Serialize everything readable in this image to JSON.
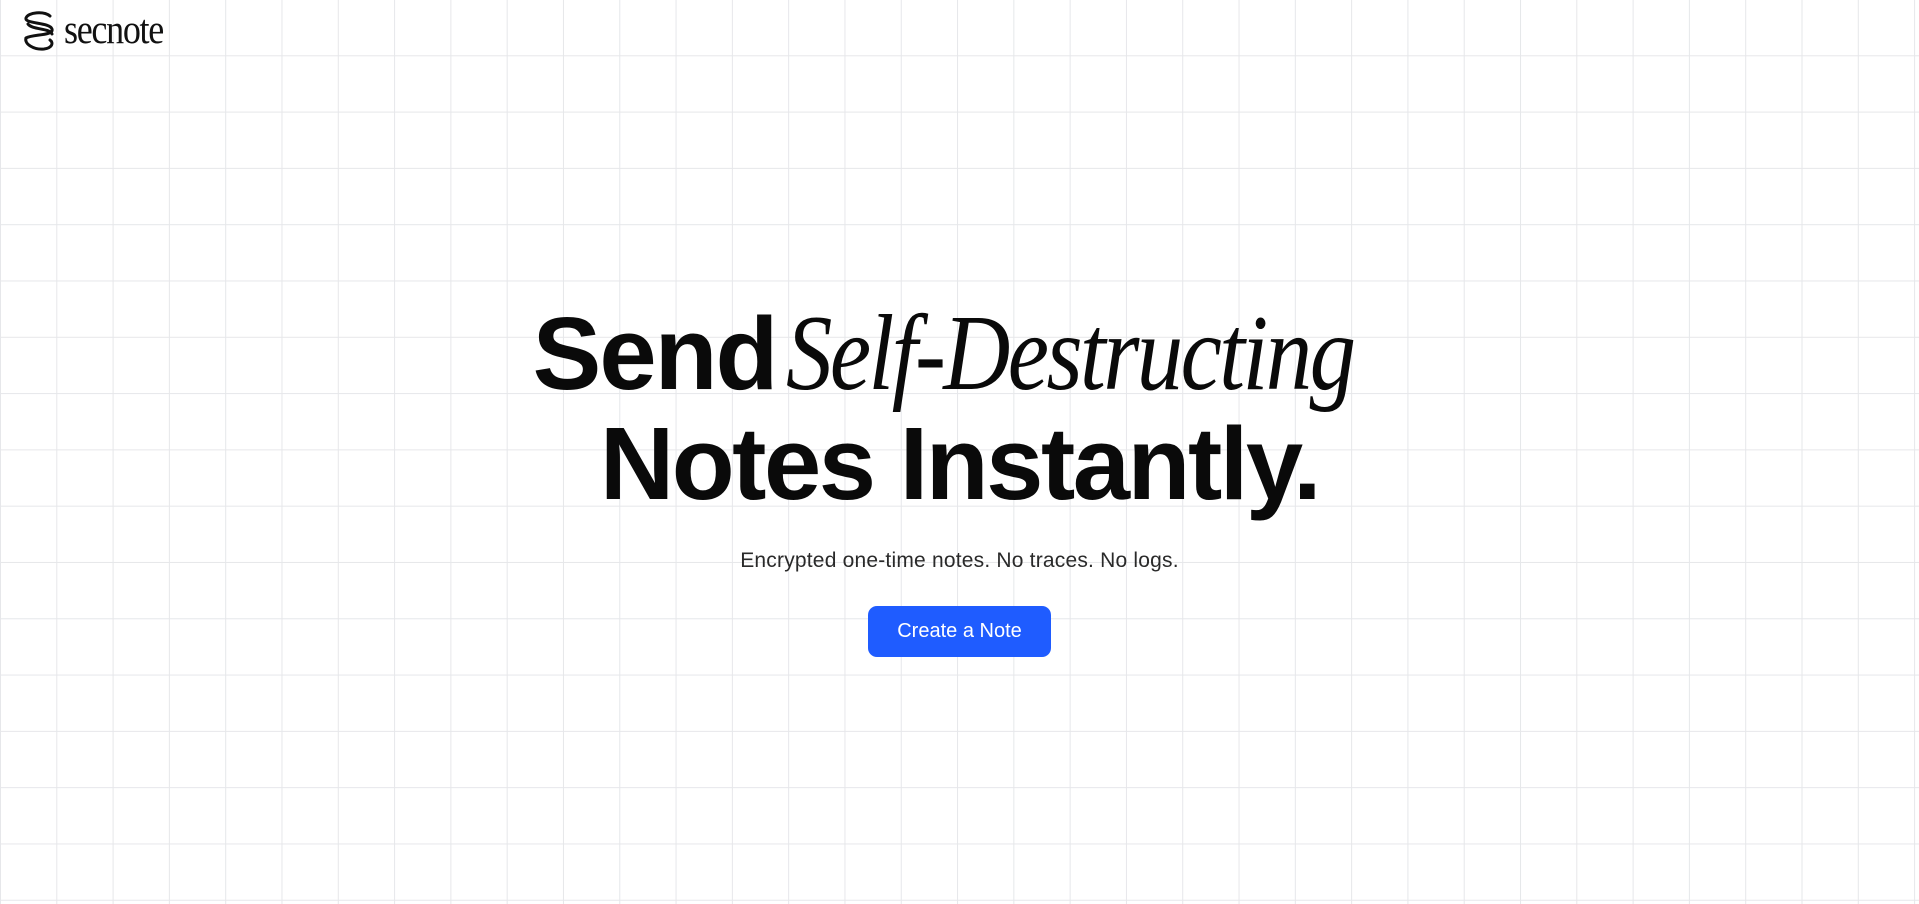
{
  "brand": {
    "name": "secnote",
    "icon": "secnote-logo-icon"
  },
  "hero": {
    "headline_word_1": "Send",
    "headline_italic": "Self-Destructing",
    "headline_line_2": "Notes Instantly.",
    "subtitle": "Encrypted one-time notes. No traces. No logs.",
    "cta_label": "Create a Note"
  },
  "colors": {
    "accent": "#1f5cff",
    "grid_line": "#e6e7ea",
    "background": "#ffffff",
    "text": "#0a0a0a"
  }
}
